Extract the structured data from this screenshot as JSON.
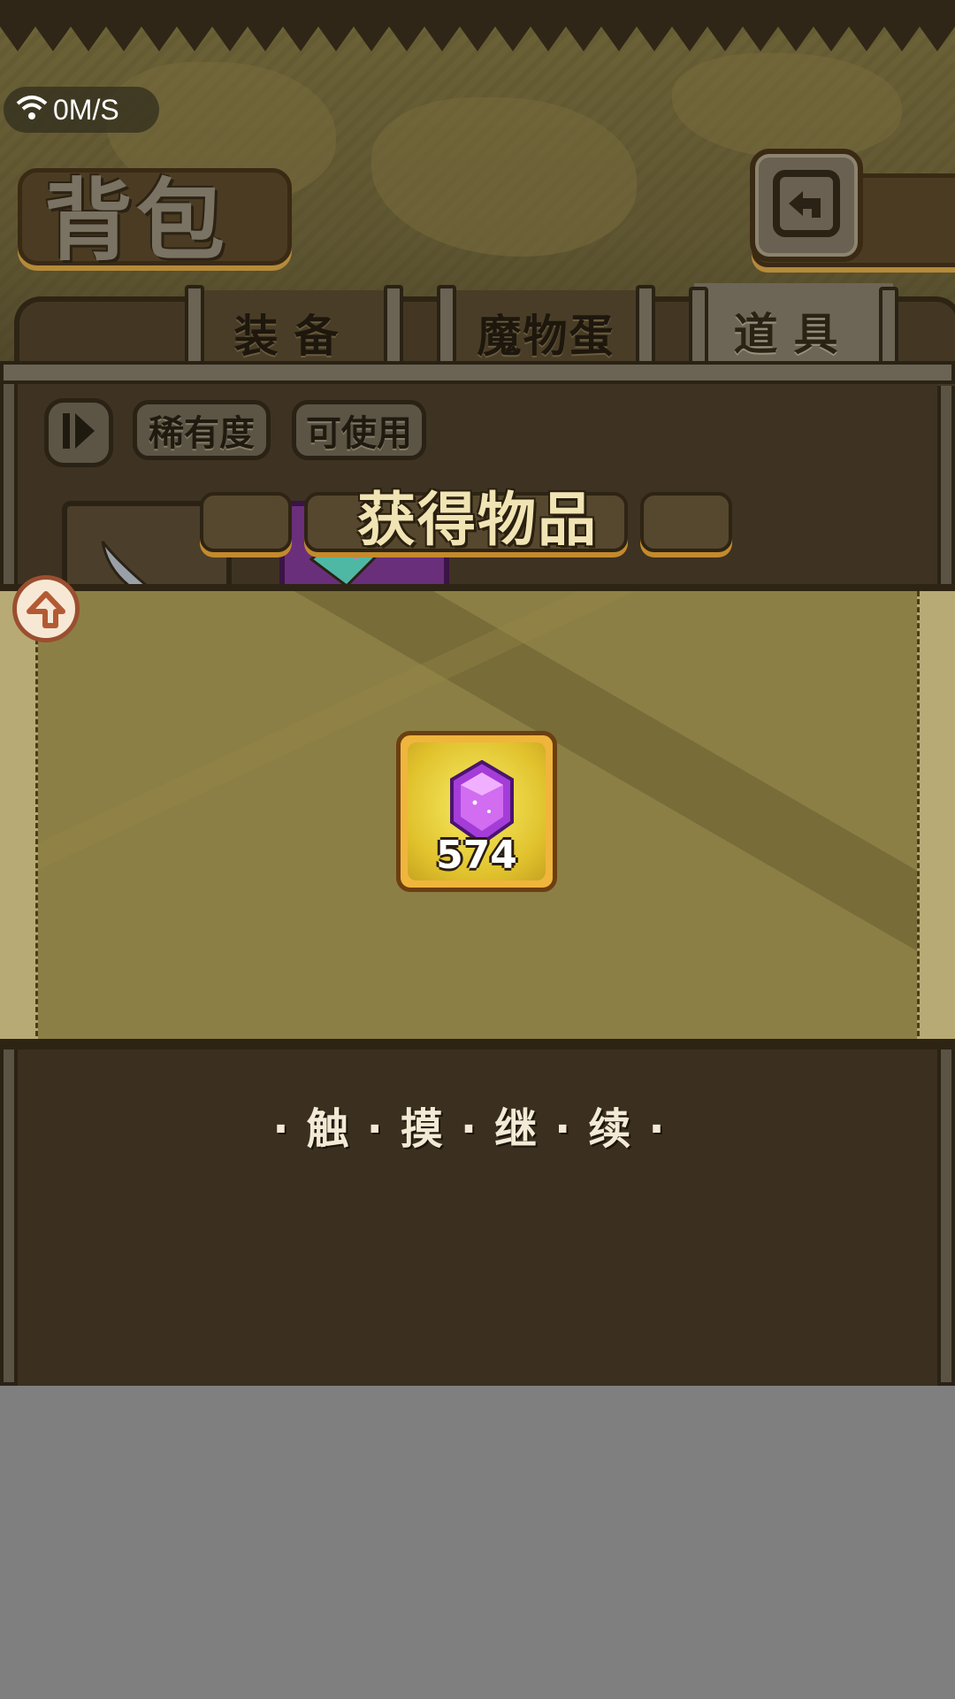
{
  "status_bar": {
    "network_speed": "0M/S",
    "icon": "wifi-icon"
  },
  "header": {
    "title": "背包",
    "back_icon": "back-arrow-icon"
  },
  "tabs": [
    {
      "label": "装备",
      "active": false
    },
    {
      "label": "魔物蛋",
      "active": false
    },
    {
      "label": "道具",
      "active": true
    }
  ],
  "filters": {
    "sort_icon": "sort-icon",
    "rarity_label": "稀有度",
    "usable_label": "可使用"
  },
  "reward_popup": {
    "title": "获得物品",
    "item": {
      "icon": "purple-gem-icon",
      "count": "574"
    },
    "prompt": "·触·摸·继·续·"
  },
  "colors": {
    "accent_gold": "#f0b53c",
    "title_cream": "#f1e4b4",
    "parchment": "#8c7f45"
  }
}
